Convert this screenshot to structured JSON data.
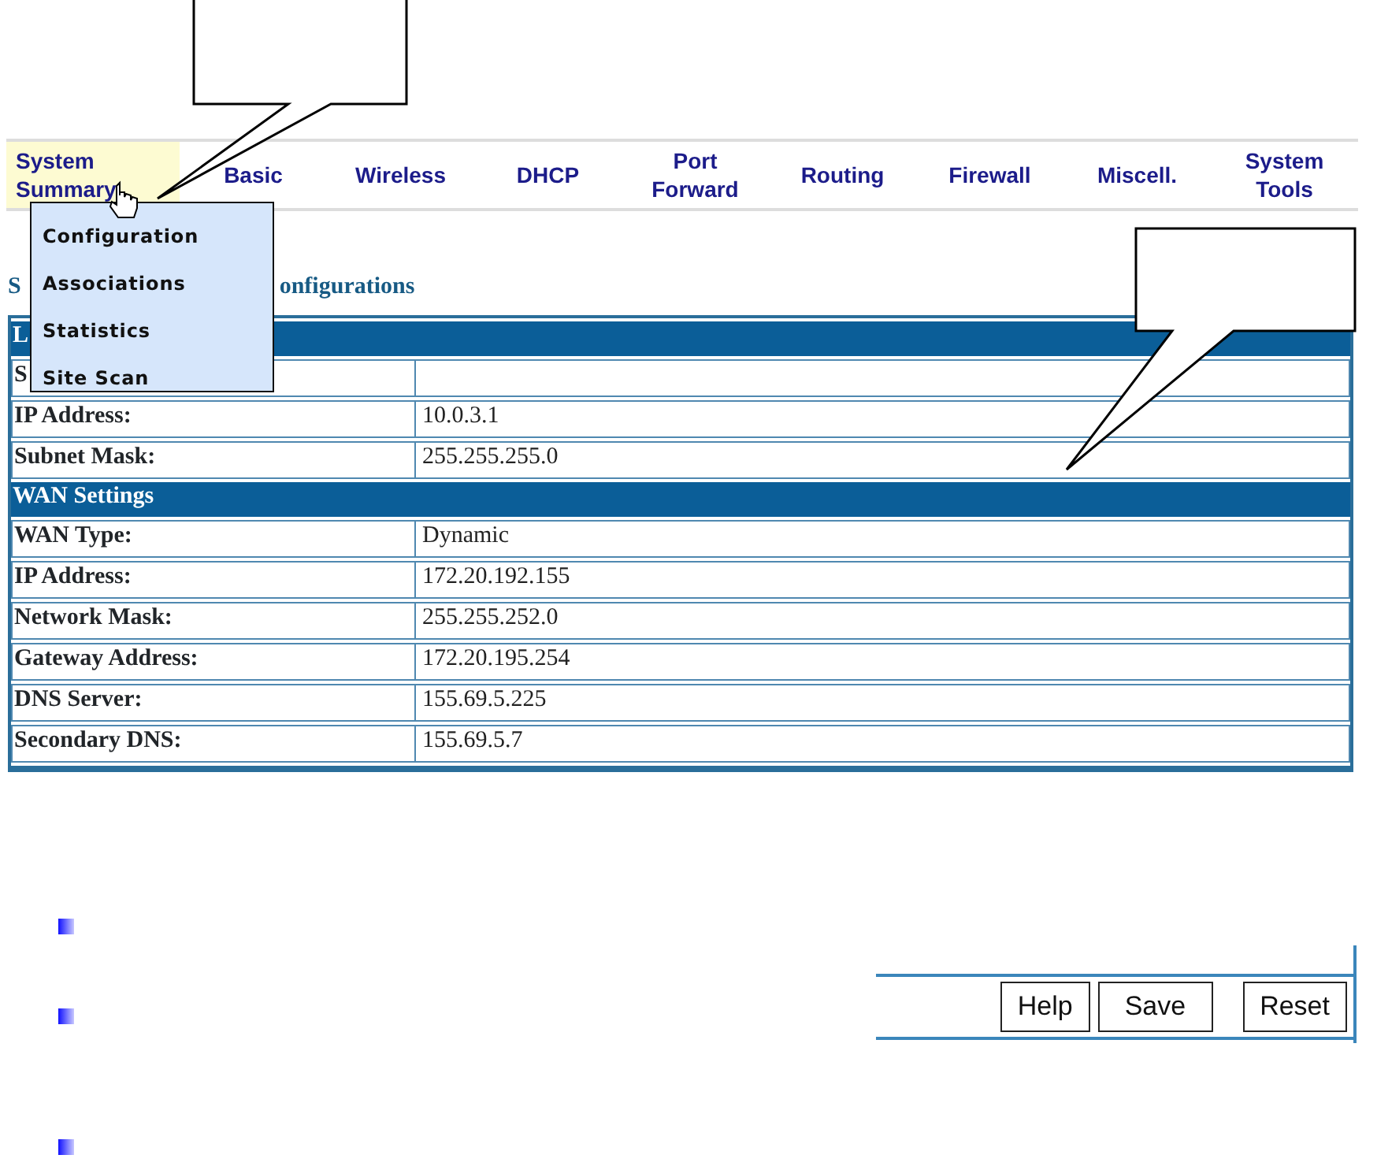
{
  "nav": {
    "items": [
      {
        "label": "System Summary",
        "selected": true
      },
      {
        "label": "Basic",
        "selected": false
      },
      {
        "label": "Wireless",
        "selected": false
      },
      {
        "label": "DHCP",
        "selected": false
      },
      {
        "label": "Port Forward",
        "selected": false
      },
      {
        "label": "Routing",
        "selected": false
      },
      {
        "label": "Firewall",
        "selected": false
      },
      {
        "label": "Miscell.",
        "selected": false
      },
      {
        "label": "System Tools",
        "selected": false
      }
    ]
  },
  "menu": {
    "items": [
      "Configuration",
      "Associations",
      "Statistics",
      "Site Scan"
    ]
  },
  "heading_parts": [
    "S",
    "onfigurations"
  ],
  "sections": [
    {
      "title": "L",
      "rows": [
        {
          "label": "S"
        },
        {
          "label": "IP Address:",
          "value": "10.0.3.1"
        },
        {
          "label": "Subnet Mask:",
          "value": "255.255.255.0"
        }
      ]
    },
    {
      "title": "WAN Settings",
      "rows": [
        {
          "label": "WAN Type:",
          "value": "Dynamic"
        },
        {
          "label": "IP Address:",
          "value": "172.20.192.155"
        },
        {
          "label": "Network Mask:",
          "value": "255.255.252.0"
        },
        {
          "label": "Gateway Address:",
          "value": "172.20.195.254"
        },
        {
          "label": "DNS Server:",
          "value": "155.69.5.225"
        },
        {
          "label": "Secondary DNS:",
          "value": "155.69.5.7"
        }
      ]
    }
  ],
  "buttons": [
    "Help",
    "Save",
    "Reset"
  ]
}
